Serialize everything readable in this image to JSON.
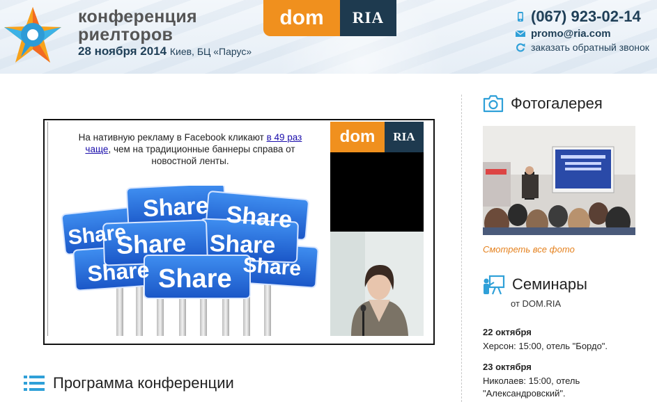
{
  "header": {
    "brand_line1": "конференция",
    "brand_line2": "риелторов",
    "date": "28 ноября 2014",
    "venue": "Киев, БЦ «Парус»",
    "logo_dom": "dom",
    "logo_ria": "RIA",
    "phone": "(067) 923-02-14",
    "email": "promo@ria.com",
    "callback": "заказать обратный звонок",
    "icons": {
      "phone": "phone-icon",
      "email": "envelope-icon",
      "callback": "refresh-icon"
    }
  },
  "banner": {
    "text_before": "На нативную рекламу в Facebook кликают ",
    "link_text": "в 49 раз чаще",
    "text_after": ", чем на традиционные баннеры справа от новостной ленты.",
    "share_word": "Share",
    "side_dom": "dom",
    "side_ria": "RIA"
  },
  "program": {
    "title": "Программа конференции"
  },
  "sidebar": {
    "gallery_title": "Фотогалерея",
    "gallery_link": "Смотреть все фото",
    "seminars_title": "Семинары",
    "seminars_sub": "от DOM.RIA",
    "seminars": [
      {
        "date": "22 октября",
        "desc": "Херсон: 15:00, отель \"Бордо\"."
      },
      {
        "date": "23 октября",
        "desc": "Николаев: 15:00, отель \"Александровский\"."
      }
    ]
  },
  "colors": {
    "orange": "#f0901e",
    "navy": "#1e3a4f",
    "accent_blue": "#2fa0d8",
    "link_orange": "#e5821f"
  }
}
